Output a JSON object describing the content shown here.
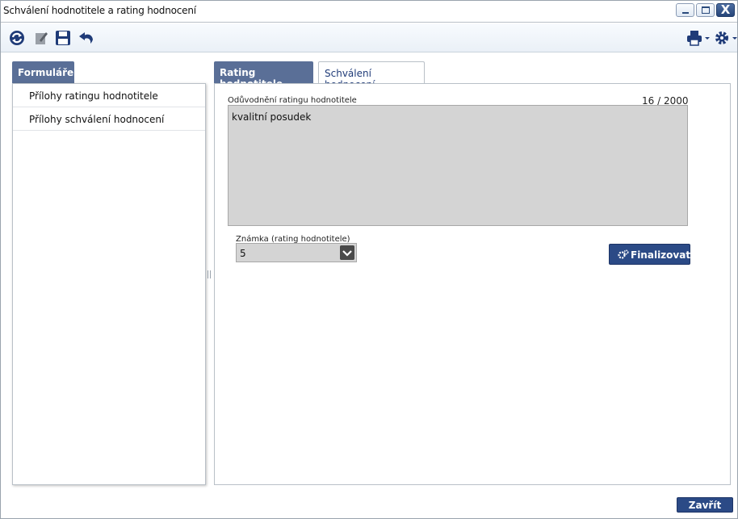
{
  "window": {
    "title": "Schválení hodnotitele a rating hodnocení",
    "buttons": [
      "minimize-icon",
      "maximize-icon",
      "close-icon"
    ],
    "close_glyph": "X"
  },
  "toolbar": {
    "left_icons": [
      "refresh-icon",
      "edit-icon",
      "save-icon",
      "undo-icon"
    ],
    "right_icons": [
      "print-icon",
      "settings-icon"
    ]
  },
  "left_panel": {
    "tab_label": "Formuláře",
    "items": [
      {
        "label": "Přílohy ratingu hodnotitele"
      },
      {
        "label": "Přílohy schválení hodnocení"
      }
    ]
  },
  "tabs": [
    {
      "label": "Rating hodnotitele",
      "active": true
    },
    {
      "label": "Schválení hodnocení",
      "active": false
    }
  ],
  "form": {
    "justification_label": "Odůvodnění ratingu hodnotitele",
    "counter": "16 / 2000",
    "justification_value": "kvalitní posudek",
    "grade_label": "Známka (rating hodnotitele)",
    "grade_value": "5",
    "finalize_label": "Finalizovat"
  },
  "footer": {
    "close_label": "Zavřít"
  },
  "colors": {
    "accent": "#5a6f97",
    "button": "#2b4a86",
    "field_bg": "#d4d4d4"
  }
}
